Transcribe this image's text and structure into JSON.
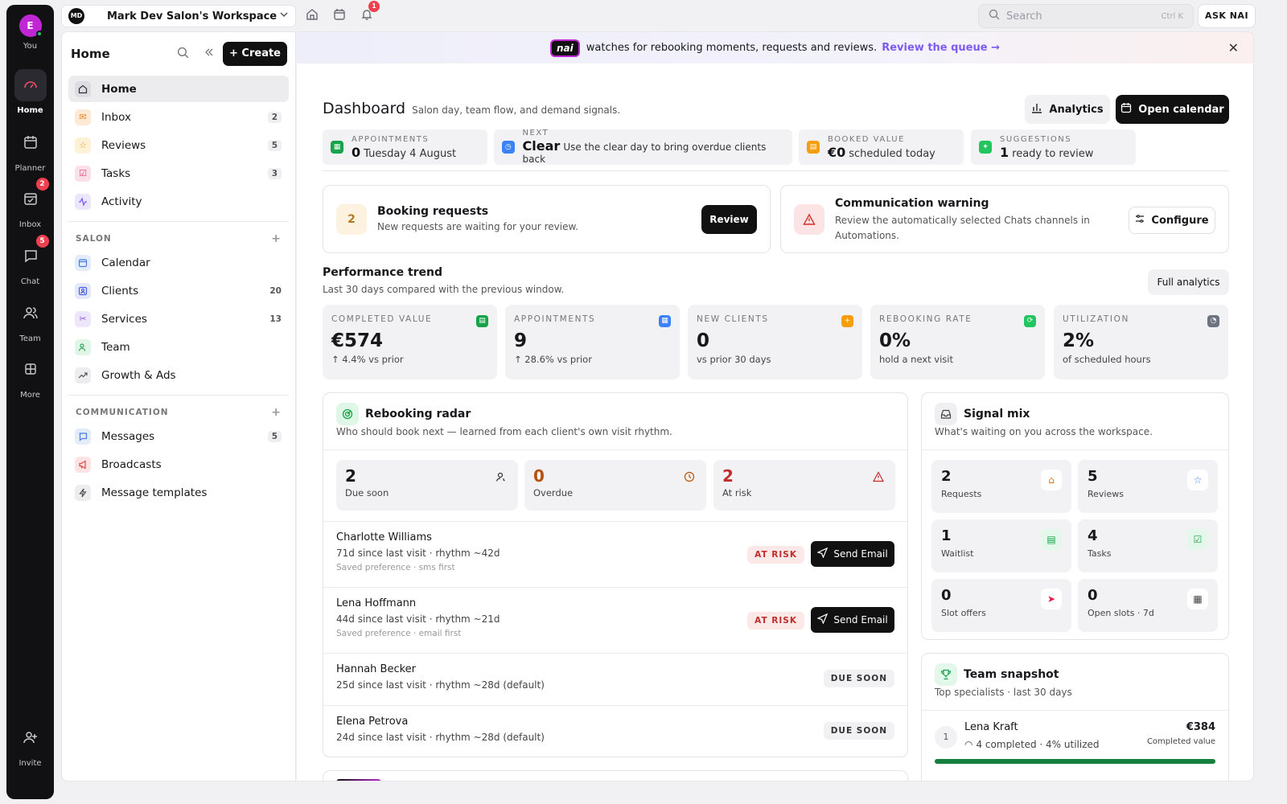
{
  "rail": {
    "avatar_initial": "E",
    "items": [
      {
        "label": "You"
      },
      {
        "label": "Home"
      },
      {
        "label": "Planner"
      },
      {
        "label": "Inbox",
        "badge": "2"
      },
      {
        "label": "Chat",
        "badge": "5"
      },
      {
        "label": "Team"
      },
      {
        "label": "More"
      },
      {
        "label": "Invite"
      }
    ]
  },
  "topbar": {
    "workspace_initials": "MD",
    "workspace_name": "Mark Dev Salon's Workspace",
    "notif_badge": "1",
    "search_placeholder": "Search",
    "search_shortcut": "Ctrl K",
    "ask_label": "ASK NAI"
  },
  "sidebar": {
    "title": "Home",
    "create_label": "Create",
    "main_items": [
      {
        "label": "Home",
        "count": ""
      },
      {
        "label": "Inbox",
        "count": "2"
      },
      {
        "label": "Reviews",
        "count": "5"
      },
      {
        "label": "Tasks",
        "count": "3"
      },
      {
        "label": "Activity",
        "count": ""
      }
    ],
    "salon_section": "SALON",
    "salon_items": [
      {
        "label": "Calendar",
        "count": ""
      },
      {
        "label": "Clients",
        "count": "20"
      },
      {
        "label": "Services",
        "count": "13"
      },
      {
        "label": "Team",
        "count": ""
      },
      {
        "label": "Growth & Ads",
        "count": ""
      }
    ],
    "comm_section": "COMMUNICATION",
    "comm_items": [
      {
        "label": "Messages",
        "count": "5"
      },
      {
        "label": "Broadcasts",
        "count": ""
      },
      {
        "label": "Message templates",
        "count": ""
      }
    ]
  },
  "banner": {
    "logo": "nai",
    "text": "watches for rebooking moments, requests and reviews.",
    "link": "Review the queue →"
  },
  "dashboard": {
    "title": "Dashboard",
    "subtitle": "Salon day, team flow, and demand signals.",
    "analytics_label": "Analytics",
    "calendar_label": "Open calendar"
  },
  "chips": [
    {
      "label": "APPOINTMENTS",
      "value": "0",
      "detail": "Tuesday 4 August"
    },
    {
      "label": "NEXT",
      "value": "Clear",
      "detail": "Use the clear day to bring overdue clients back"
    },
    {
      "label": "BOOKED VALUE",
      "value": "€0",
      "detail": "scheduled today"
    },
    {
      "label": "SUGGESTIONS",
      "value": "1",
      "detail": "ready to review"
    }
  ],
  "booking": {
    "count": "2",
    "title": "Booking requests",
    "desc": "New requests are waiting for your review.",
    "button": "Review"
  },
  "warning": {
    "title": "Communication warning",
    "desc": "Review the automatically selected Chats channels in Automations.",
    "button": "Configure"
  },
  "performance": {
    "title": "Performance trend",
    "subtitle": "Last 30 days compared with the previous window.",
    "button": "Full analytics",
    "stats": [
      {
        "label": "COMPLETED VALUE",
        "value": "€574",
        "sub": "↑ 4.4% vs prior"
      },
      {
        "label": "APPOINTMENTS",
        "value": "9",
        "sub": "↑ 28.6% vs prior"
      },
      {
        "label": "NEW CLIENTS",
        "value": "0",
        "sub": "vs prior 30 days"
      },
      {
        "label": "REBOOKING RATE",
        "value": "0%",
        "sub": "hold a next visit"
      },
      {
        "label": "UTILIZATION",
        "value": "2%",
        "sub": "of scheduled hours"
      }
    ]
  },
  "radar": {
    "title": "Rebooking radar",
    "subtitle": "Who should book next — learned from each client's own visit rhythm.",
    "metrics": [
      {
        "value": "2",
        "label": "Due soon"
      },
      {
        "value": "0",
        "label": "Overdue"
      },
      {
        "value": "2",
        "label": "At risk"
      }
    ],
    "clients": [
      {
        "name": "Charlotte Williams",
        "detail": "71d since last visit · rhythm ~42d",
        "pref": "Saved preference · sms first",
        "tag": "AT RISK",
        "action": "Send Email"
      },
      {
        "name": "Lena Hoffmann",
        "detail": "44d since last visit · rhythm ~21d",
        "pref": "Saved preference · email first",
        "tag": "AT RISK",
        "action": "Send Email"
      },
      {
        "name": "Hannah Becker",
        "detail": "25d since last visit · rhythm ~28d (default)",
        "tag": "DUE SOON"
      },
      {
        "name": "Elena Petrova",
        "detail": "24d since last visit · rhythm ~28d (default)",
        "tag": "DUE SOON"
      }
    ]
  },
  "signal": {
    "title": "Signal mix",
    "subtitle": "What's waiting on you across the workspace.",
    "items": [
      {
        "value": "2",
        "label": "Requests"
      },
      {
        "value": "5",
        "label": "Reviews"
      },
      {
        "value": "1",
        "label": "Waitlist"
      },
      {
        "value": "4",
        "label": "Tasks"
      },
      {
        "value": "0",
        "label": "Slot offers"
      },
      {
        "value": "0",
        "label": "Open slots · 7d"
      }
    ]
  },
  "team": {
    "title": "Team snapshot",
    "subtitle": "Top specialists · last 30 days",
    "rank": "1",
    "name": "Lena Kraft",
    "detail": "4 completed · 4% utilized",
    "value": "€384",
    "value_label": "Completed value",
    "progress": 1.0
  }
}
